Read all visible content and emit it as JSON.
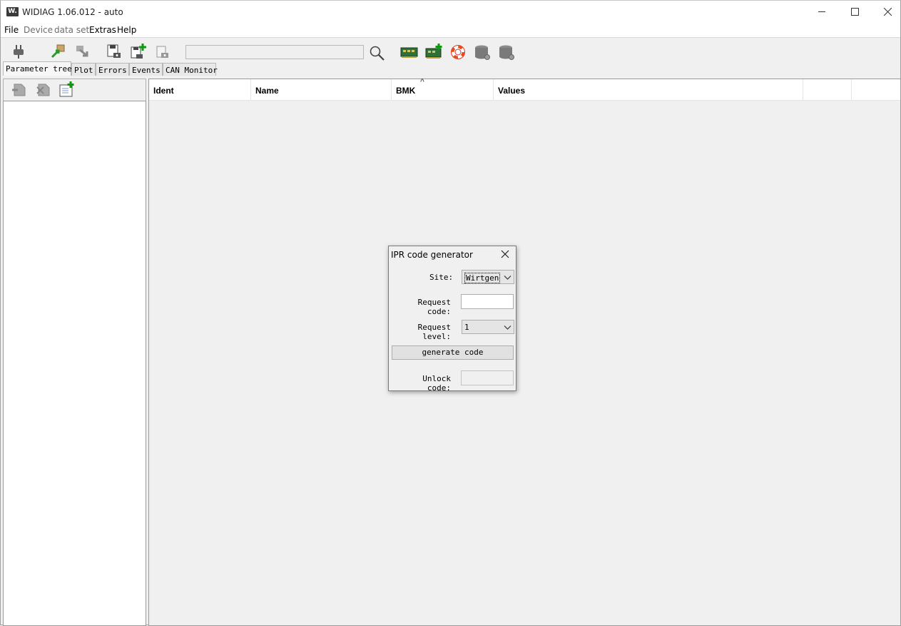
{
  "window": {
    "title": "WIDIAG 1.06.012 - auto",
    "app_icon_text": "W."
  },
  "menubar": {
    "items": [
      {
        "label": "File",
        "enabled": true
      },
      {
        "label": "Device",
        "enabled": false
      },
      {
        "label": "data set",
        "enabled": false
      },
      {
        "label": "Extras",
        "enabled": true
      },
      {
        "label": "Help",
        "enabled": true
      }
    ]
  },
  "toolbar": {
    "search_value": "",
    "icons": [
      "connect-plug-icon",
      "upload-package-icon",
      "download-icon",
      "save-disk-icon",
      "save-add-icon",
      "save-disabled-icon",
      "search-icon",
      "ecu-board-icon",
      "ecu-board-add-icon",
      "lifebuoy-help-icon",
      "database-icon",
      "database-2-icon"
    ]
  },
  "tabs": [
    {
      "label": "Parameter tree",
      "active": true
    },
    {
      "label": "Plot",
      "active": false
    },
    {
      "label": "Errors",
      "active": false
    },
    {
      "label": "Events",
      "active": false
    },
    {
      "label": "CAN Monitor",
      "active": false
    }
  ],
  "table": {
    "columns": [
      "Ident",
      "Name",
      "BMK",
      "Values",
      "",
      ""
    ],
    "sort_indicator": "^",
    "rows": []
  },
  "dialog": {
    "title": "IPR code generator",
    "site_label": "Site:",
    "site_value": "Wirtgen",
    "request_code_label": "Request code:",
    "request_code_value": "",
    "request_level_label": "Request level:",
    "request_level_value": "1",
    "generate_button": "generate code",
    "unlock_code_label": "Unlock code:",
    "unlock_code_value": ""
  }
}
